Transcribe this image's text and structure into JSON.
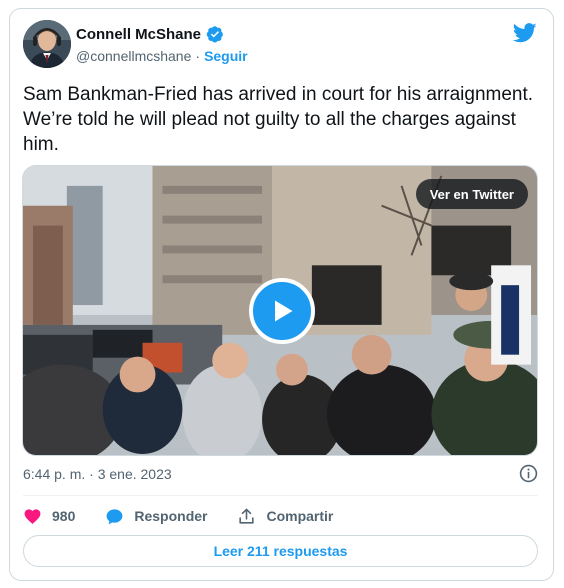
{
  "author": {
    "name": "Connell McShane",
    "handle": "@connellmcshane",
    "separator": "·",
    "follow_label": "Seguir",
    "verified": true
  },
  "tweet": {
    "text": "Sam Bankman-Fried has arrived in court for his arraignment. We’re told he will plead not guilty to all the charges against him."
  },
  "media": {
    "watch_label": "Ver en Twitter",
    "type": "video"
  },
  "meta": {
    "timestamp": "6:44 p. m. · 3 ene. 2023"
  },
  "actions": {
    "likes_count": "980",
    "reply_label": "Responder",
    "share_label": "Compartir"
  },
  "read_replies_label": "Leer 211 respuestas",
  "colors": {
    "accent": "#1d9bf0",
    "like": "#f91880",
    "text": "#0f1419",
    "muted": "#536471",
    "border": "#cfd9de"
  },
  "icons": {
    "twitter": "twitter-bird-icon",
    "verified": "verified-badge-icon",
    "play": "play-icon",
    "info": "info-icon",
    "like": "heart-icon",
    "reply": "speech-bubble-icon",
    "share": "share-icon"
  }
}
